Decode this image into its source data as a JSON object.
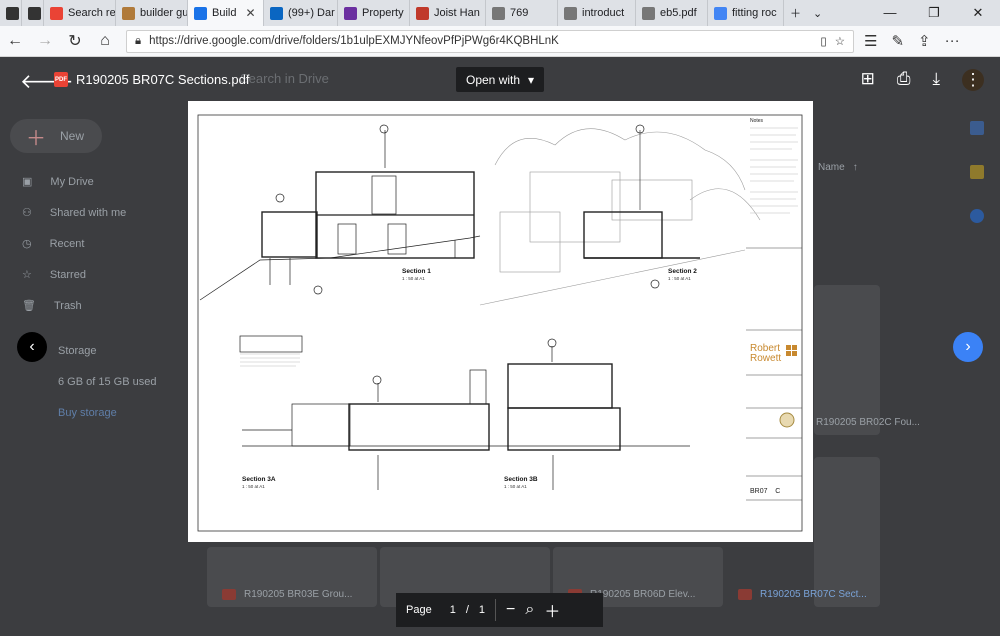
{
  "tabs": [
    {
      "label": "",
      "icon": "tab-actions-icon",
      "color": "#333333"
    },
    {
      "label": "",
      "icon": "set-aside-icon",
      "color": "#333333"
    },
    {
      "label": "Search re",
      "icon": "gmail-icon",
      "color": "#ea4335"
    },
    {
      "label": "builder gu",
      "icon": "house-icon",
      "color": "#b07a3a"
    },
    {
      "label": "Build",
      "icon": "drive-icon",
      "color": "#1a73e8",
      "active": true
    },
    {
      "label": "(99+) Dar",
      "icon": "linkedin-icon",
      "color": "#0a66c2"
    },
    {
      "label": "Property",
      "icon": "zillow-icon",
      "color": "#6b2fa0"
    },
    {
      "label": "Joist Han",
      "icon": "site-icon",
      "color": "#c0392b"
    },
    {
      "label": "769",
      "icon": "page-icon",
      "color": "#777777"
    },
    {
      "label": "introduct",
      "icon": "page-icon",
      "color": "#777777"
    },
    {
      "label": "eb5.pdf",
      "icon": "page-icon",
      "color": "#777777"
    },
    {
      "label": "fitting roc",
      "icon": "google-icon",
      "color": "#4285f4"
    }
  ],
  "address": {
    "url": "https://drive.google.com/drive/folders/1b1ulpEXMJYNfeovPfPjPWg6r4KQBHLnK"
  },
  "drive": {
    "new_label": "New",
    "sidebar": [
      "My Drive",
      "Shared with me",
      "Recent",
      "Starred",
      "Trash"
    ],
    "storage_label": "Storage",
    "storage_text": "6 GB of 15 GB used",
    "buy_storage": "Buy storage",
    "search_placeholder": "Search in Drive",
    "sort_label": "Name",
    "files": [
      "R190205 BR03E Grou...",
      "R190205 BR06D Elev...",
      "R190205 BR07C Sect...",
      "R190205 BR02C Fou..."
    ]
  },
  "viewer": {
    "file_name": "R190205 BR07C Sections.pdf",
    "pdf_badge": "PDF",
    "open_with": "Open with",
    "page_label": "Page",
    "page_current": "1",
    "page_sep": "/",
    "page_total": "1"
  },
  "drawing": {
    "sections": [
      {
        "title": "Section 1",
        "scale": "1 : 50 at A1"
      },
      {
        "title": "Section 2",
        "scale": "1 : 50 at A1"
      },
      {
        "title": "Section 3A",
        "scale": "1 : 50 at A1"
      },
      {
        "title": "Section 3B",
        "scale": "1 : 50 at A1"
      }
    ],
    "firm_line1": "Robert",
    "firm_line2": "Rowett",
    "drawing_no": "BR07",
    "revision": "C",
    "notes_title": "Notes"
  }
}
